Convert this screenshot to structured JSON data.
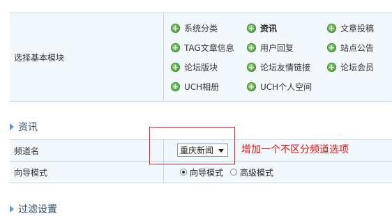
{
  "modules": {
    "label": "选择基本模块",
    "items": [
      {
        "label": "系统分类",
        "bold": false
      },
      {
        "label": "资讯",
        "bold": true
      },
      {
        "label": "文章投稿",
        "bold": false
      },
      {
        "label": "TAG文章信息",
        "bold": false
      },
      {
        "label": "用户回复",
        "bold": false
      },
      {
        "label": "站点公告",
        "bold": false
      },
      {
        "label": "论坛版块",
        "bold": false
      },
      {
        "label": "论坛友情链接",
        "bold": false
      },
      {
        "label": "论坛会员",
        "bold": false
      },
      {
        "label": "UCH相册",
        "bold": false
      },
      {
        "label": "UCH个人空间",
        "bold": false
      }
    ]
  },
  "news_section": {
    "title": "资讯",
    "channel_label": "频道名",
    "channel_select": "重庆新闻",
    "mode_label": "向导模式",
    "mode_options": [
      "向导模式",
      "高级模式"
    ],
    "mode_selected": "向导模式"
  },
  "annotation": "增加一个不区分频道选项",
  "filter_section": {
    "title": "过滤设置"
  },
  "colors": {
    "accent": "#5f9ad0",
    "annotation": "#d11111",
    "icon_green": "#3f9a2c"
  }
}
